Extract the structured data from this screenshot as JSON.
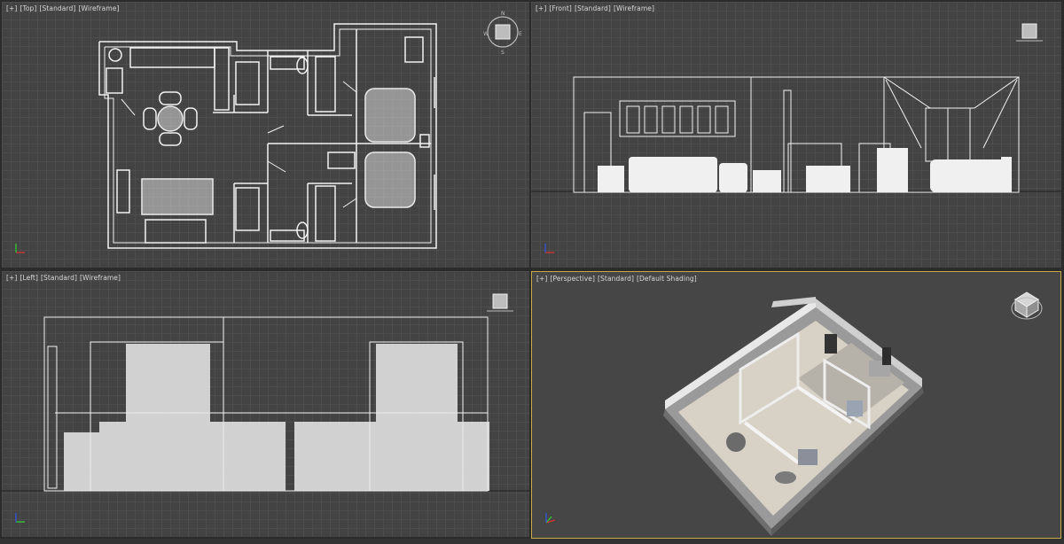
{
  "viewports": {
    "top": {
      "plus": "[+]",
      "view": "[Top]",
      "mode": "[Standard]",
      "shading": "[Wireframe]"
    },
    "front": {
      "plus": "[+]",
      "view": "[Front]",
      "mode": "[Standard]",
      "shading": "[Wireframe]"
    },
    "left": {
      "plus": "[+]",
      "view": "[Left]",
      "mode": "[Standard]",
      "shading": "[Wireframe]"
    },
    "perspective": {
      "plus": "[+]",
      "view": "[Perspective]",
      "mode": "[Standard]",
      "shading": "[Default Shading]"
    }
  },
  "colors": {
    "active_border": "#c7a94a",
    "wireframe": "#f2f2f2",
    "viewport_bg": "#434343"
  },
  "icons": [
    "viewcube-icon",
    "axis-gizmo-icon"
  ]
}
